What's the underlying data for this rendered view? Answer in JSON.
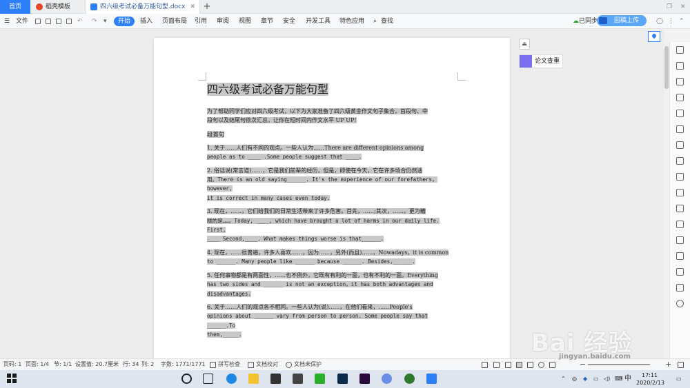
{
  "tabs": {
    "home": "首页",
    "template": "稻壳模板",
    "document": "四六级考试必备万能句型.docx"
  },
  "menu": {
    "file": "文件",
    "items": [
      "开始",
      "插入",
      "页面布局",
      "引用",
      "审阅",
      "视图",
      "章节",
      "安全",
      "开发工具",
      "特色应用"
    ],
    "search": "查找",
    "sync": "已同步",
    "upload": "回稿上传"
  },
  "panel": {
    "paper_check": "论文查重"
  },
  "document": {
    "title": "四六级考试必备万能句型",
    "intro_line1": "为了帮助同学们应对四六级考试，以下为大家准备了四六级黄金作文句子集合，首段句、中",
    "intro_line2": "段句以及结尾句依次汇总，让你在短时间内作文水平 UP UP!",
    "section": "段首句",
    "paras": [
      {
        "lines": [
          "1. 关于……人们有不同的观点。一些人认为……There are different opinions among",
          "people as to ____ .Some people suggest that ____."
        ]
      },
      {
        "lines": [
          "2. 俗话说(常言道)……，它是我们前辈的经历，但是，即使在今天，它在许多场合仍然适",
          "用。There is an old saying______. It's the experience of our forefathers，however,",
          "it is correct in many cases even today."
        ]
      },
      {
        "lines": [
          "3. 现在，……，它们给我们的日常生活带来了许多危害。首先，……;其次，……。更为糟",
          "糕的是……。Today, ____, which have brought a lot of harms in our daily life. First,",
          "____ Second,____. What makes things worse is that______."
        ]
      },
      {
        "lines": [
          "4. 现在，……很普遍，许多人喜欢……，因为……，另外(而且)……，Nowadays，it is common",
          "to ______. Many people like ______ because ______. Besides,______."
        ]
      },
      {
        "lines": [
          "5. 任何事物都是有两面性，……也不例外，它既有有利的一面，也有不利的一面。Everything",
          "has two sides and ______ is not an exception，it has both advantages and",
          "disadvantages."
        ]
      },
      {
        "lines": [
          "6. 关于……人们的观点各不相同。一些人认为(说)……，在他们看来，……People's",
          "opinions about ______ vary from person to person. Some people say that ______.To",
          "them,_____."
        ]
      }
    ]
  },
  "status": {
    "page_code": "页码: 1",
    "page": "页面: 1/4",
    "section": "节: 1/1",
    "setting": "设置值: 20.7厘米",
    "row": "行: 34",
    "col": "列: 2",
    "wordcount": "字数: 1771/1771",
    "spellcheck": "拼写检查",
    "proofread": "文档校对",
    "protect": "文档未保护",
    "zoom_minus": "−",
    "zoom_plus": "+"
  },
  "taskbar": {
    "ime": "中",
    "time": "17:11",
    "date": "2020/2/13"
  },
  "watermark": {
    "brand": "Bai 经验",
    "url": "jingyan.baidu.com"
  },
  "colors": {
    "accent": "#2d7ff9",
    "highlight": "#c8c8c8"
  }
}
